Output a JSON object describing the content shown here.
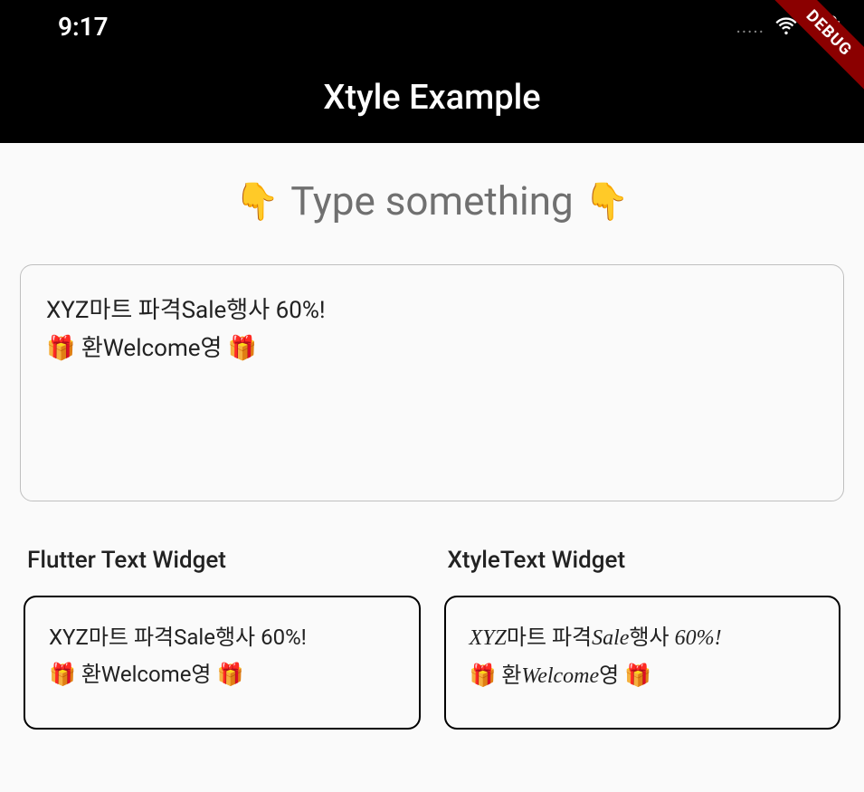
{
  "status": {
    "time": "9:17",
    "dots": "....."
  },
  "debug_label": "DEBUG",
  "app_title": "Xtyle Example",
  "prompt": {
    "emoji_left": "👇",
    "text": "Type something",
    "emoji_right": "👇"
  },
  "input": {
    "value": "XYZ마트 파격Sale행사 60%!\n🎁 환Welcome영 🎁"
  },
  "columns": {
    "left": {
      "header": "Flutter Text Widget",
      "content": "XYZ마트 파격Sale행사 60%!\n🎁 환Welcome영 🎁"
    },
    "right": {
      "header": "XtyleText Widget",
      "parts": {
        "p1": "XYZ",
        "p2": "마트 파격",
        "p3": "Sale",
        "p4": "행사 ",
        "p5": "60%!",
        "p6": "🎁 환",
        "p7": "Welcome",
        "p8": "영 🎁"
      }
    }
  }
}
